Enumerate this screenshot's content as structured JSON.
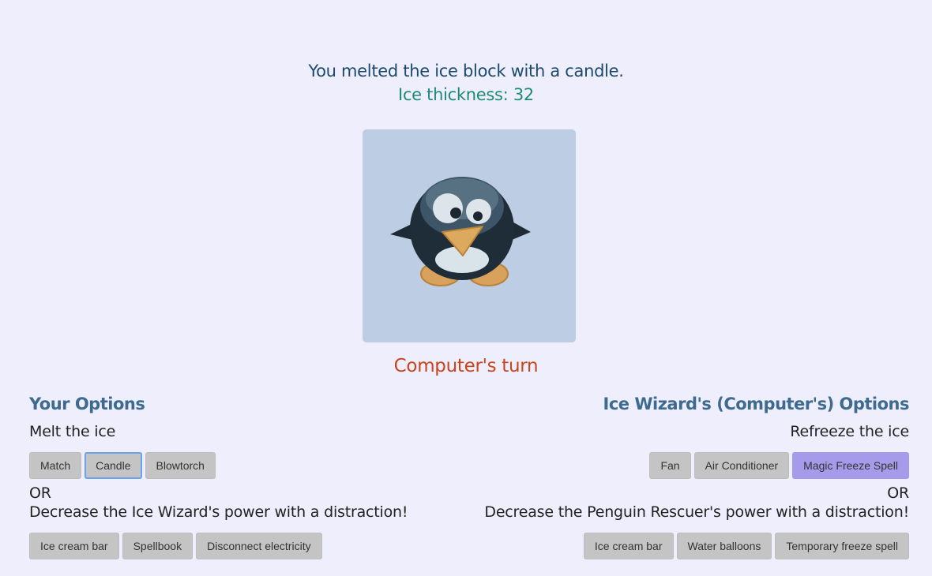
{
  "status": {
    "message": "You melted the ice block with a candle.",
    "thickness_label": "Ice thickness: 32",
    "ice_thickness": 32,
    "turn_label": "Computer's turn"
  },
  "player": {
    "title": "Your Options",
    "melt_label": "Melt the ice",
    "melt_options": [
      "Match",
      "Candle",
      "Blowtorch"
    ],
    "or_label": "OR",
    "distract_label": "Decrease the Ice Wizard's power with a distraction!",
    "distract_options": [
      "Ice cream bar",
      "Spellbook",
      "Disconnect electricity"
    ]
  },
  "computer": {
    "title": "Ice Wizard's (Computer's) Options",
    "refreeze_label": "Refreeze the ice",
    "refreeze_options": [
      "Fan",
      "Air Conditioner",
      "Magic Freeze Spell"
    ],
    "or_label": "OR",
    "distract_label": "Decrease the Penguin Rescuer's power with a distraction!",
    "distract_options": [
      "Ice cream bar",
      "Water balloons",
      "Temporary freeze spell"
    ]
  },
  "colors": {
    "background": "#efeefd",
    "ice_block": "#bdcde3",
    "turn": "#c8451b",
    "thickness": "#1e8a7a",
    "highlight_button": "#a69bea"
  },
  "icons": {
    "penguin": "penguin-icon"
  }
}
